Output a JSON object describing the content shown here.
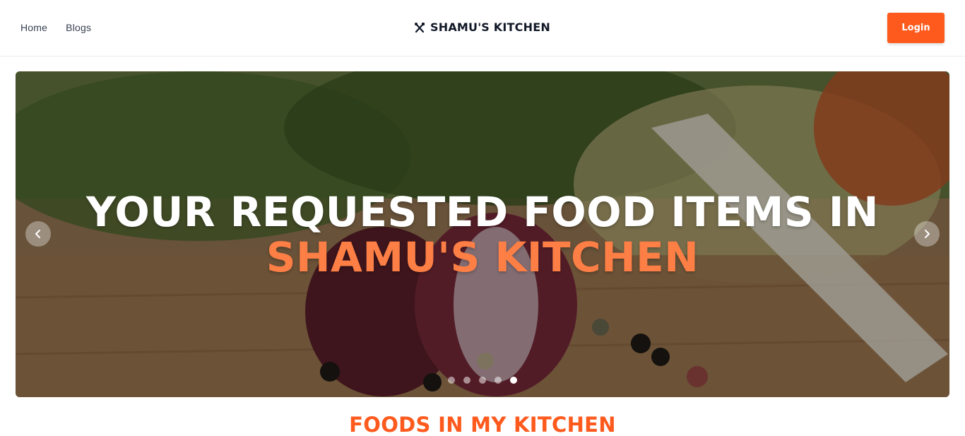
{
  "nav": {
    "links": [
      "Home",
      "Blogs"
    ],
    "brand": "SHAMU'S KITCHEN",
    "brand_icon": "utensils-crossed-icon",
    "login_label": "Login"
  },
  "hero": {
    "line1": "YOUR REQUESTED FOOD ITEMS IN",
    "line2": "SHAMU'S KITCHEN",
    "slide_count": 5,
    "active_slide": 5,
    "prev_icon": "chevron-left-icon",
    "next_icon": "chevron-right-icon"
  },
  "section": {
    "title": "FOODS IN MY KITCHEN"
  },
  "colors": {
    "accent": "#fe5a1d",
    "hero_highlight": "#fd7f45"
  }
}
